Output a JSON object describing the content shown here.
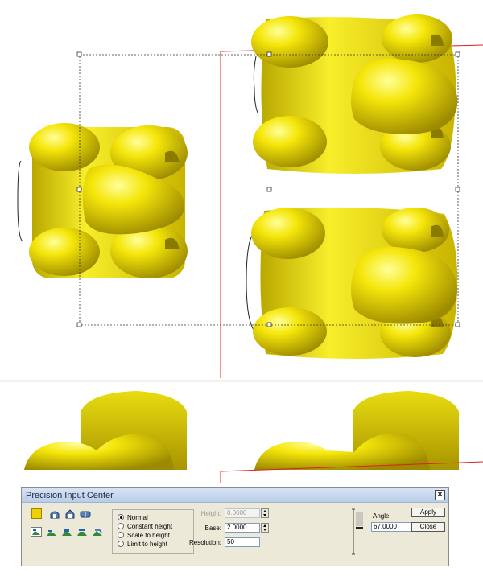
{
  "dialog": {
    "title": "Precision Input Center",
    "close_label": "✕",
    "mode_options": [
      {
        "label": "Normal",
        "selected": true
      },
      {
        "label": "Constant height",
        "selected": false
      },
      {
        "label": "Scale to height",
        "selected": false
      },
      {
        "label": "Limit to height",
        "selected": false
      }
    ],
    "height": {
      "label": "Height:",
      "value": "0.0000",
      "enabled": false
    },
    "base": {
      "label": "Base:",
      "value": "2.0000",
      "enabled": true
    },
    "resolution": {
      "label": "Resolution:",
      "value": "50",
      "enabled": true
    },
    "angle": {
      "label": "Angle:",
      "value": "67.0000"
    },
    "apply_label": "Apply",
    "close_button_label": "Close"
  },
  "colors": {
    "model_yellow": "#f2e600",
    "selection_red": "#e02020",
    "swatch": "#f0d000"
  },
  "icons": [
    "color-swatch-icon",
    "dome-icon",
    "house-icon",
    "capsule-icon",
    "model-tool-1-icon",
    "model-tool-2-icon",
    "model-tool-3-icon",
    "model-tool-4-icon",
    "model-tool-5-icon"
  ]
}
